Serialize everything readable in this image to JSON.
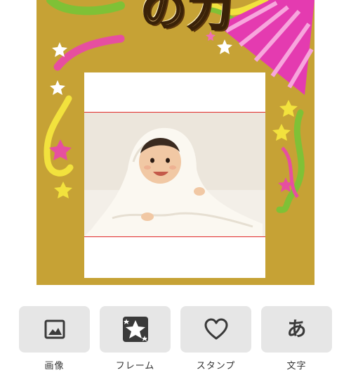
{
  "frame": {
    "title_text": "の力",
    "background_color": "#c6a235",
    "decorations": [
      "star-icon",
      "party-cracker-icon",
      "confetti-ribbon-icon"
    ]
  },
  "photo": {
    "subject": "baby wrapped in white towel",
    "guide_line_color": "#e02a2a"
  },
  "toolbar": {
    "items": [
      {
        "label": "画像",
        "icon": "image-icon"
      },
      {
        "label": "フレーム",
        "icon": "frame-star-icon"
      },
      {
        "label": "スタンプ",
        "icon": "heart-icon"
      },
      {
        "label": "文字",
        "icon_text": "あ",
        "icon": "text-icon"
      }
    ]
  }
}
